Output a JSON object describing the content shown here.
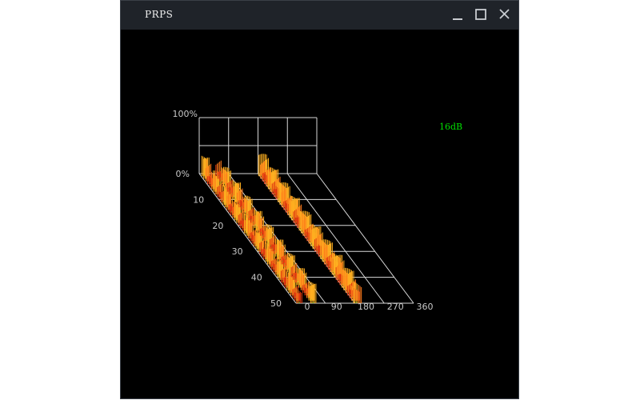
{
  "window": {
    "title": "PRPS",
    "controls": [
      "minimize-icon",
      "maximize-icon",
      "close-icon"
    ]
  },
  "amplitude_readout": "16dB",
  "chart_data": {
    "type": "bar",
    "subtype": "prps-3d",
    "y_axis_labels": [
      "100%",
      "0%"
    ],
    "phase_axis_labels": [
      "0",
      "90",
      "180",
      "270",
      "360"
    ],
    "cycle_axis_labels": [
      "10",
      "20",
      "30",
      "40",
      "50"
    ],
    "phase_range": [
      0,
      360
    ],
    "cycle_range": [
      0,
      50
    ],
    "amplitude_range": [
      0,
      100
    ],
    "clusters": [
      {
        "phase_start": 2,
        "phase_end": 18,
        "amplitude": 38
      },
      {
        "phase_start": 45,
        "phase_end": 62,
        "amplitude": 35
      },
      {
        "phase_start": 176,
        "phase_end": 200,
        "amplitude": 40
      }
    ],
    "colors": {
      "grid": "#d9d9d9",
      "bar_high": "#ff7a1a",
      "bar_mid": "#e03a10",
      "bar_low": "#ffb020",
      "bar_base": "#7ab82a",
      "readout": "#00e000"
    }
  }
}
